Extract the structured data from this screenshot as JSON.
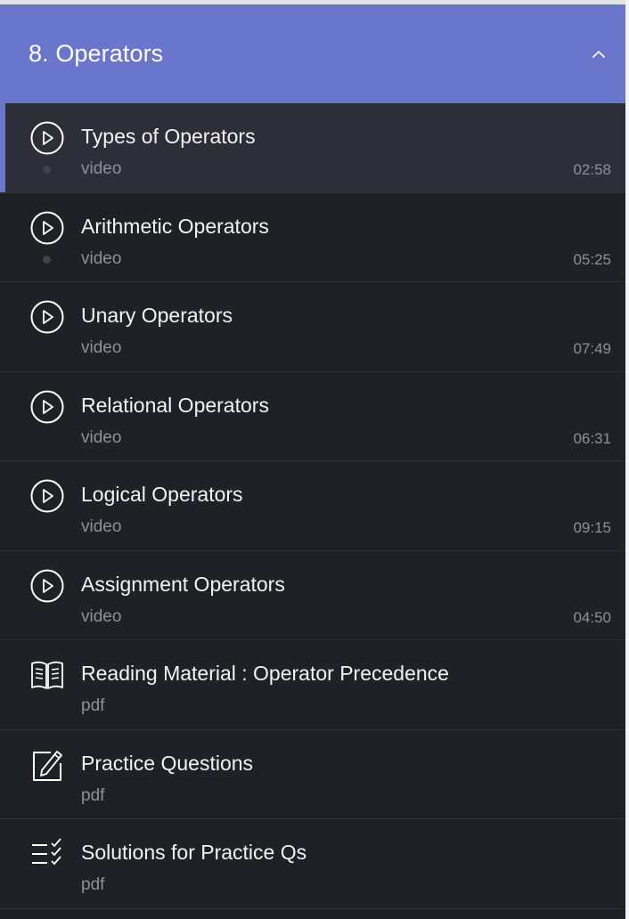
{
  "section": {
    "title": "8. Operators"
  },
  "items": [
    {
      "title": "Types of Operators",
      "type": "video",
      "duration": "02:58",
      "icon": "play-circle-icon"
    },
    {
      "title": "Arithmetic Operators",
      "type": "video",
      "duration": "05:25",
      "icon": "play-circle-icon"
    },
    {
      "title": "Unary Operators",
      "type": "video",
      "duration": "07:49",
      "icon": "play-circle-icon"
    },
    {
      "title": "Relational Operators",
      "type": "video",
      "duration": "06:31",
      "icon": "play-circle-icon"
    },
    {
      "title": "Logical Operators",
      "type": "video",
      "duration": "09:15",
      "icon": "play-circle-icon"
    },
    {
      "title": "Assignment Operators",
      "type": "video",
      "duration": "04:50",
      "icon": "play-circle-icon"
    },
    {
      "title": "Reading Material : Operator Precedence",
      "type": "pdf",
      "icon": "open-book-icon"
    },
    {
      "title": "Practice Questions",
      "type": "pdf",
      "icon": "notepad-pencil-icon"
    },
    {
      "title": "Solutions for Practice Qs",
      "type": "pdf",
      "icon": "checklist-icon"
    }
  ],
  "colors": {
    "accent": "#6a76cc",
    "background": "#1f2126",
    "active_row": "#2c2f37"
  }
}
